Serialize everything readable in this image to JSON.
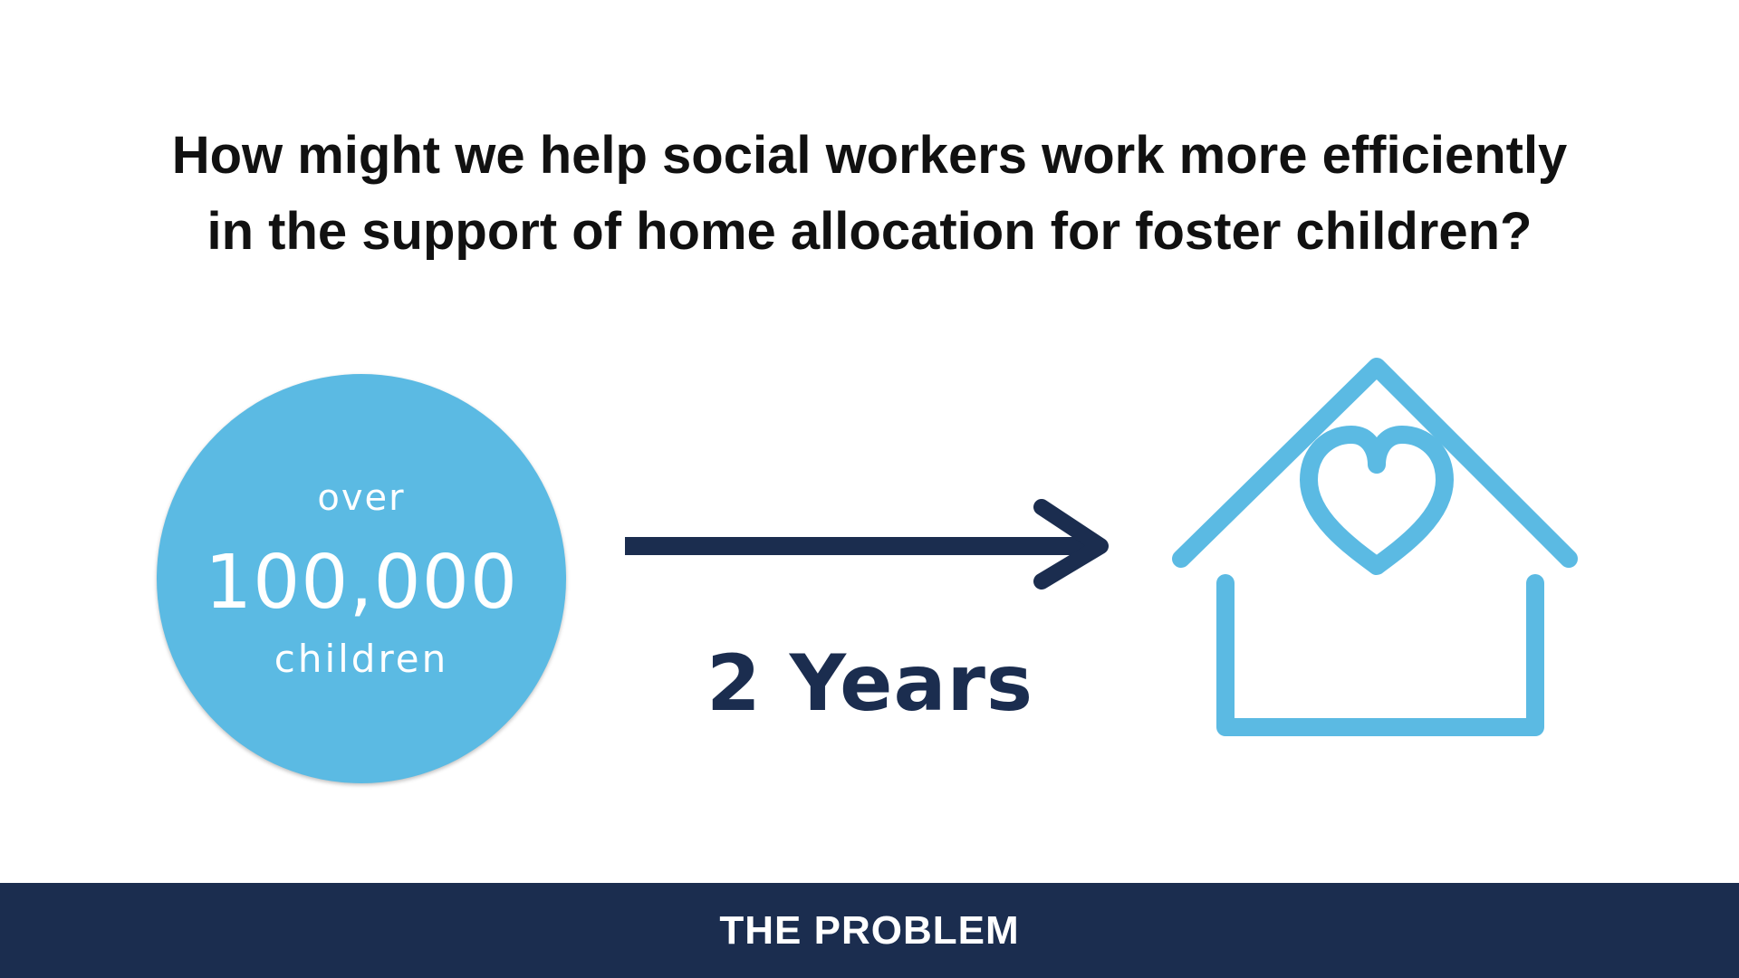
{
  "headline": {
    "line1": "How might we help social workers work more efficiently",
    "line2": "in the support of home allocation for foster children?"
  },
  "stat": {
    "prefix": "over",
    "number": "100,000",
    "suffix": "children"
  },
  "duration": "2 Years",
  "icons": {
    "arrow": "arrow-right-icon",
    "house": "house-heart-icon"
  },
  "footer": {
    "label": "THE PROBLEM"
  },
  "colors": {
    "accent_blue": "#5bbae3",
    "navy": "#1b2d4f",
    "text": "#111111",
    "background": "#ffffff"
  }
}
